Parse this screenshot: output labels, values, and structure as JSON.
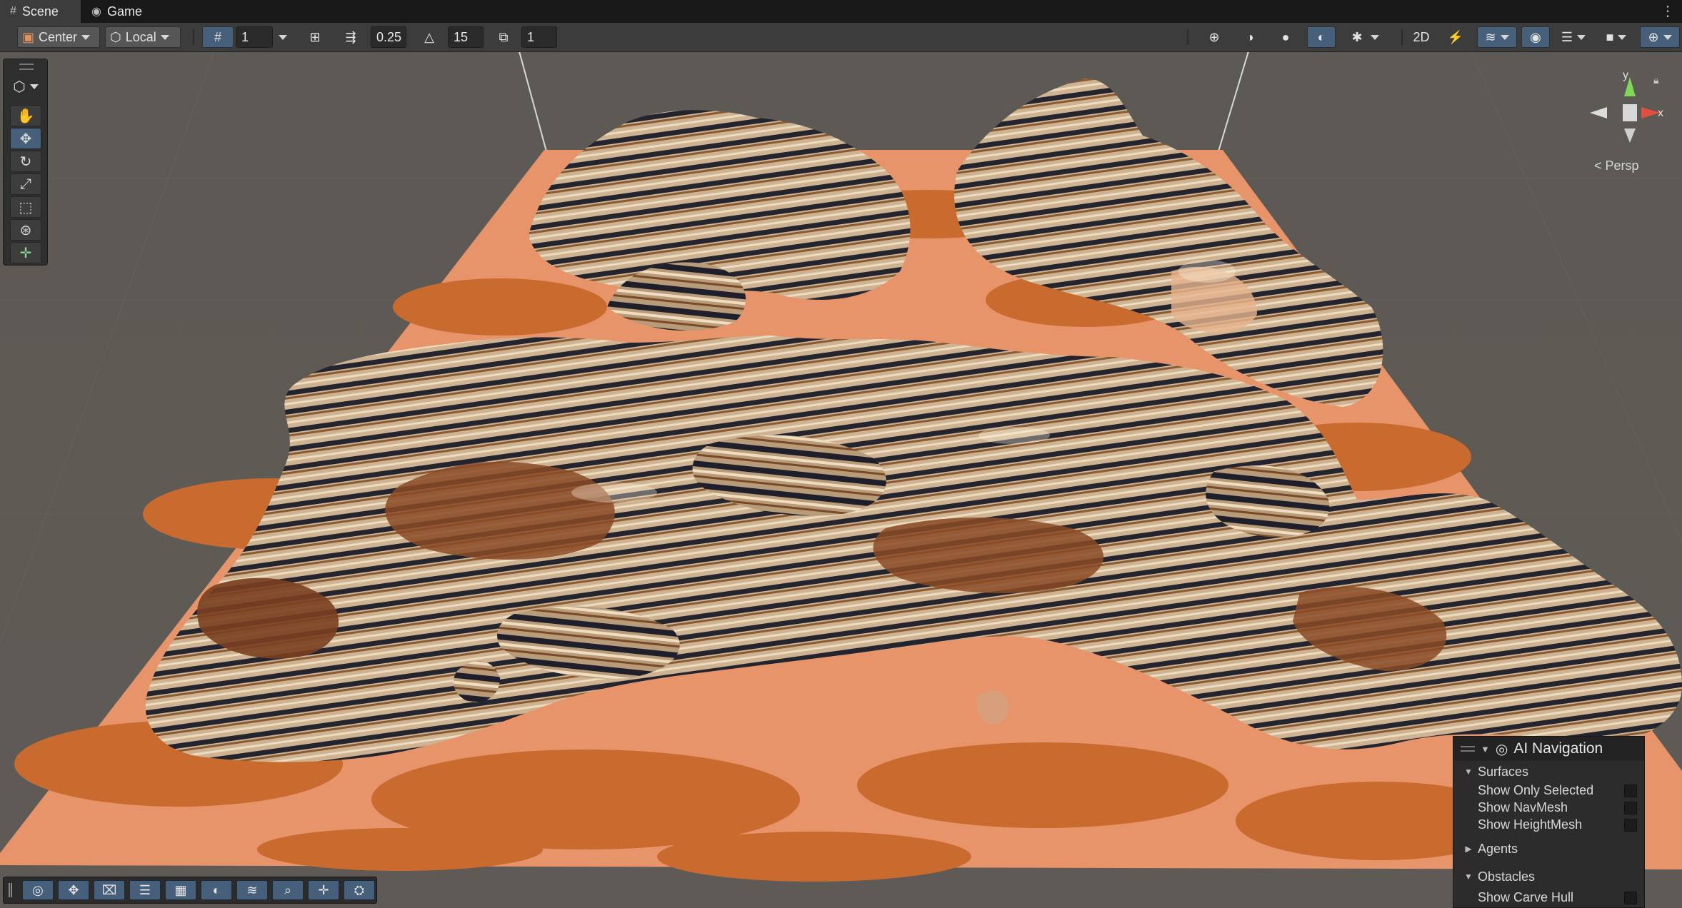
{
  "tabs": [
    {
      "label": "Scene",
      "icon": "hash-icon"
    },
    {
      "label": "Game",
      "icon": "gamepad-icon"
    }
  ],
  "toolbar": {
    "pivot_mode": "Center",
    "pivot_rotation": "Local",
    "grid_size": "1",
    "move_snap": "0.25",
    "rotate_snap": "15",
    "scale_snap": "1"
  },
  "tool_palette": {
    "view_tool": "cube-icon",
    "tools": [
      "hand-icon",
      "move-icon",
      "rotate-icon",
      "scale-icon",
      "rect-icon",
      "transform-icon",
      "custom-tool-icon"
    ],
    "active_tool": "move-icon"
  },
  "gizmo": {
    "y_label": "y",
    "x_label": "x",
    "projection": "Persp"
  },
  "ai_navigation": {
    "title": "AI Navigation",
    "surfaces": {
      "label": "Surfaces",
      "items": [
        "Show Only Selected",
        "Show NavMesh",
        "Show HeightMesh"
      ]
    },
    "agents": {
      "label": "Agents"
    },
    "obstacles": {
      "label": "Obstacles",
      "items": [
        "Show Carve Hull"
      ]
    }
  },
  "colors": {
    "accent": "#46607c",
    "panel": "#3c3c3c",
    "terrain_light": "#e8946a",
    "terrain_dark": "#c96a2f",
    "stripe_dark": "#2a2a3a",
    "stripe_light": "#c9b394"
  }
}
